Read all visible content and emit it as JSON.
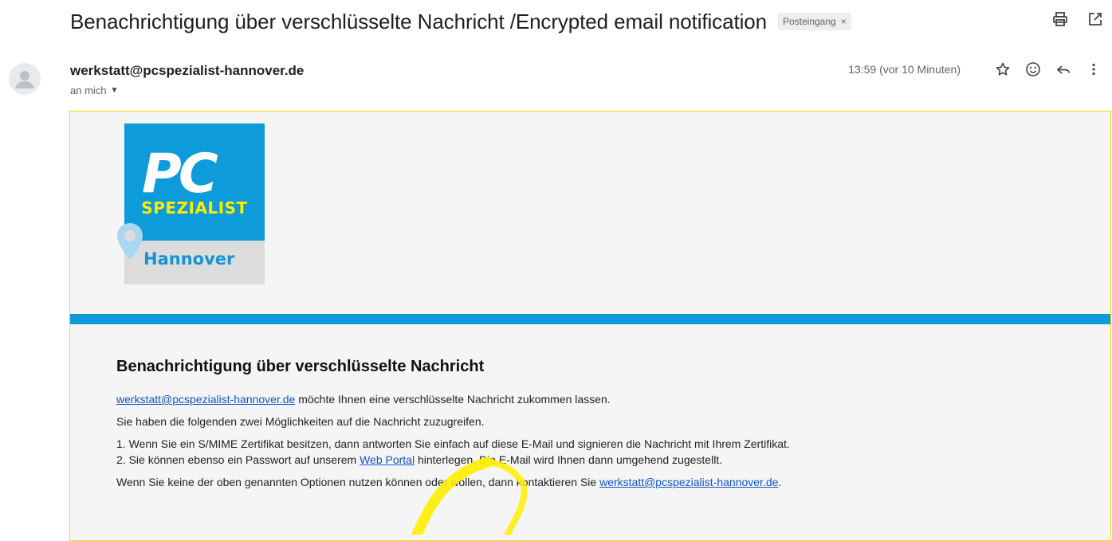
{
  "subject": {
    "title": "Benachrichtigung über verschlüsselte Nachricht /Encrypted email notification",
    "label": "Posteingang",
    "label_remove": "×"
  },
  "toolbar": {
    "print_icon": "printer-icon",
    "popout_icon": "open-in-new-window-icon"
  },
  "message": {
    "sender": "werkstatt@pcspezialist-hannover.de",
    "recipient": "an mich",
    "time": "13:59 (vor 10 Minuten)",
    "icons": [
      "star-icon",
      "emoji-icon",
      "reply-icon",
      "more-vert-icon"
    ]
  },
  "logo": {
    "brand": "PC",
    "line1": "SPEZIALIST",
    "city": "Hannover",
    "colors": {
      "blue": "#0e9bd9",
      "yellow": "#ffed00",
      "gray": "#dcdcdc"
    }
  },
  "body": {
    "heading": "Benachrichtigung über verschlüsselte Nachricht",
    "intro_link": "werkstatt@pcspezialist-hannover.de",
    "intro_rest": " möchte Ihnen eine verschlüsselte Nachricht zukommen lassen.",
    "options_text": "Sie haben die folgenden zwei Möglichkeiten auf die Nachricht zuzugreifen.",
    "option1": "1. Wenn Sie ein S/MIME Zertifikat besitzen, dann antworten Sie einfach auf diese E-Mail und signieren die Nachricht mit Ihrem Zertifikat.",
    "option2_pre": "2. Sie können ebenso ein Passwort auf unserem ",
    "option2_link": "Web Portal",
    "option2_post": " hinterlegen. Die E-Mail wird Ihnen dann umgehend zugestellt.",
    "contact_pre": "Wenn Sie keine der oben genannten Optionen nutzen können oder wollen, dann kontaktieren Sie ",
    "contact_link": "werkstatt@pcspezialist-hannover.de",
    "contact_post": "."
  },
  "annotation": {
    "color": "#ffee00"
  }
}
